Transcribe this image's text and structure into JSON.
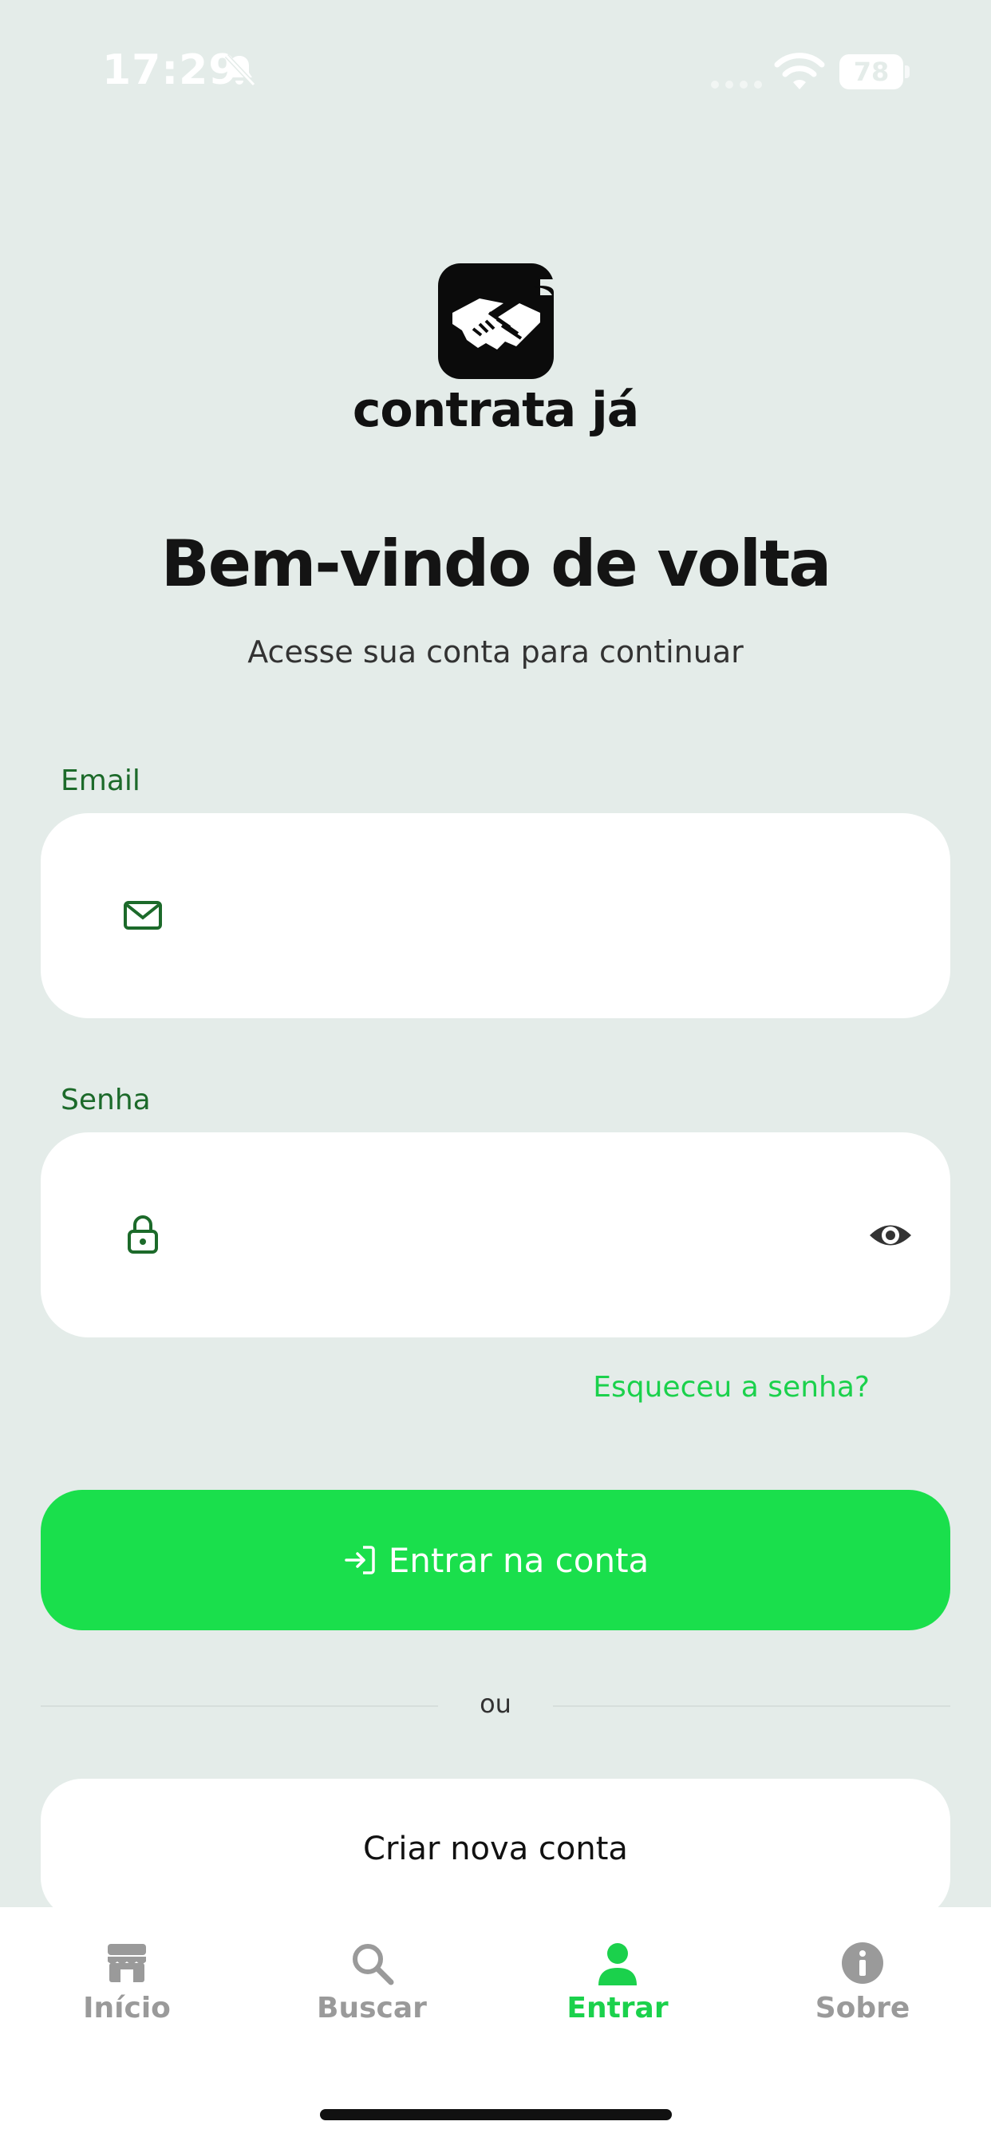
{
  "status_bar": {
    "time": "17:29",
    "battery": "78"
  },
  "brand": {
    "name": "contrata já"
  },
  "welcome": {
    "title": "Bem-vindo de volta",
    "subtitle": "Acesse sua conta para continuar"
  },
  "form": {
    "email_label": "Email",
    "email_value": "",
    "password_label": "Senha",
    "password_value": "",
    "forgot_password": "Esqueceu a senha?",
    "login_button": "Entrar na conta",
    "divider": "ou",
    "create_account": "Criar nova conta"
  },
  "bottom_nav": {
    "items": [
      {
        "label": "Início",
        "icon": "store-icon",
        "active": false
      },
      {
        "label": "Buscar",
        "icon": "search-icon",
        "active": false
      },
      {
        "label": "Entrar",
        "icon": "user-icon",
        "active": true
      },
      {
        "label": "Sobre",
        "icon": "info-icon",
        "active": false
      }
    ]
  },
  "colors": {
    "background": "#e4ece9",
    "primary_green": "#1adf4c",
    "label_green": "#1c6a2a",
    "inactive_gray": "#9a9a9a"
  }
}
